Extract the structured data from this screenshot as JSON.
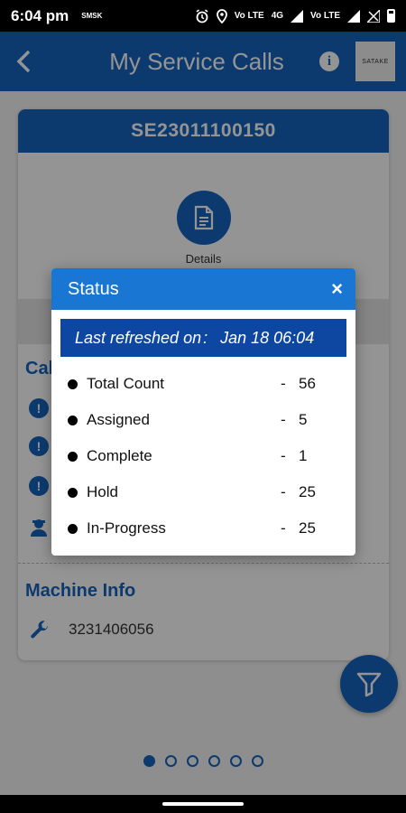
{
  "status_bar": {
    "time": "6:04 pm",
    "mini": "SMSK",
    "network": "4G",
    "volte1": "Vo LTE",
    "volte2": "Vo LTE"
  },
  "header": {
    "title": "My Service Calls",
    "logo_text": "SATAKE",
    "info_glyph": "i"
  },
  "card": {
    "call_id": "SE23011100150",
    "details_label": "Details",
    "call_section_title": "Cal",
    "machine_section_title": "Machine Info",
    "machine_number": "3231406056"
  },
  "pagination": {
    "count": 6,
    "active": 0
  },
  "dialog": {
    "title": "Status",
    "close_glyph": "×",
    "refresh_label": "Last refreshed on",
    "refresh_sep": ":",
    "refresh_value": "Jan 18 06:04",
    "items": [
      {
        "label": "Total Count",
        "dash": "-",
        "value": "56"
      },
      {
        "label": "Assigned",
        "dash": "-",
        "value": "5"
      },
      {
        "label": "Complete",
        "dash": "-",
        "value": "1"
      },
      {
        "label": "Hold",
        "dash": "-",
        "value": "25"
      },
      {
        "label": "In-Progress",
        "dash": "-",
        "value": "25"
      }
    ]
  },
  "colors": {
    "primary": "#1565c0",
    "dialog_header": "#1976d2",
    "refresh_bar": "#0d47a1"
  }
}
